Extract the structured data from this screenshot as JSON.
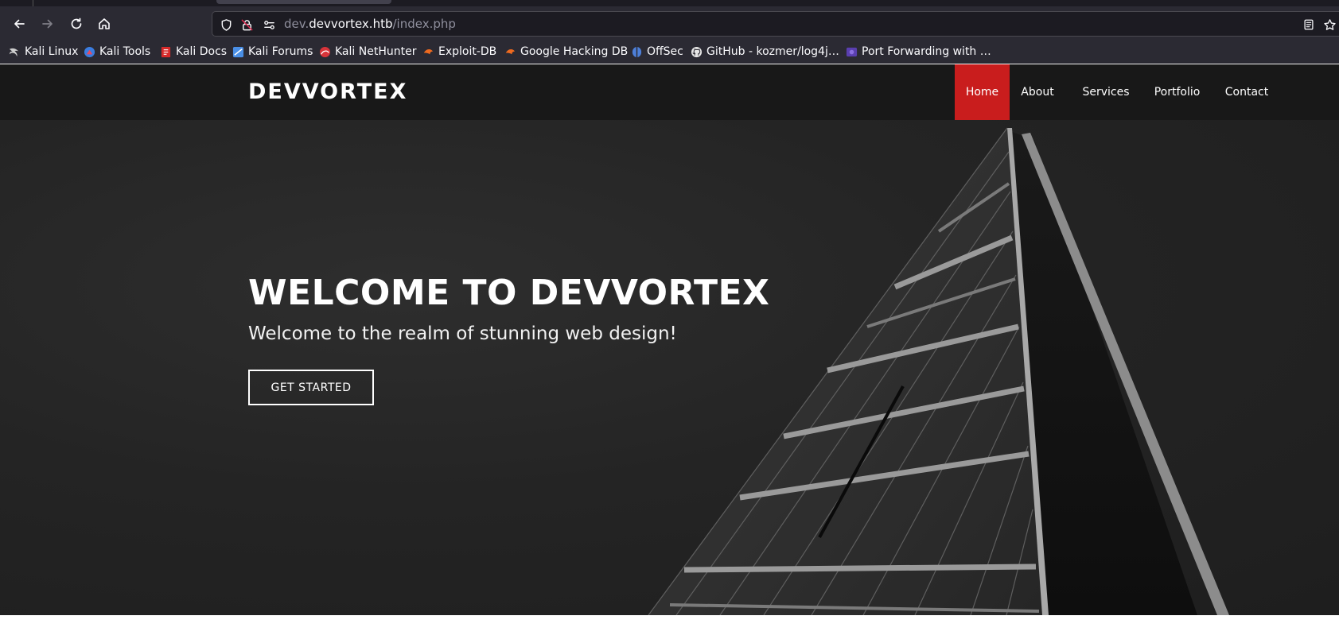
{
  "browser": {
    "url_prefix": "dev.",
    "url_host": "devvortex.htb",
    "url_path": "/index.php",
    "icons": {
      "back": "arrow-left-icon",
      "forward": "arrow-right-icon",
      "reload": "reload-icon",
      "home": "home-icon",
      "tracking": "shield-icon",
      "insecure": "lock-slash-icon",
      "permissions": "permissions-icon",
      "reader": "reader-view-icon",
      "bookmark": "star-icon"
    },
    "bookmarks": [
      {
        "label": "Kali Linux",
        "icon": "kali-dragon-icon",
        "color": "#cfcfcf"
      },
      {
        "label": "Kali Tools",
        "icon": "kali-tools-icon",
        "color": "#3b7de0"
      },
      {
        "label": "Kali Docs",
        "icon": "kali-docs-icon",
        "color": "#d82a2a"
      },
      {
        "label": "Kali Forums",
        "icon": "kali-forums-icon",
        "color": "#4a8fe6"
      },
      {
        "label": "Kali NetHunter",
        "icon": "nethunter-icon",
        "color": "#d8343a"
      },
      {
        "label": "Exploit-DB",
        "icon": "exploitdb-icon",
        "color": "#ef6a1f"
      },
      {
        "label": "Google Hacking DB",
        "icon": "ghdb-icon",
        "color": "#ef6a1f"
      },
      {
        "label": "OffSec",
        "icon": "offsec-icon",
        "color": "#4d7fd8"
      },
      {
        "label": "GitHub - kozmer/log4j…",
        "icon": "github-icon",
        "color": "#e6e6e6"
      },
      {
        "label": "Port Forwarding with …",
        "icon": "port-forwarding-icon",
        "color": "#5a3fb0"
      }
    ]
  },
  "site": {
    "brand": "DEVVORTEX",
    "nav": [
      {
        "label": "Home",
        "active": true
      },
      {
        "label": "About",
        "active": false
      },
      {
        "label": "Services",
        "active": false
      },
      {
        "label": "Portfolio",
        "active": false
      },
      {
        "label": "Contact",
        "active": false
      }
    ],
    "hero": {
      "title": "WELCOME TO DEVVORTEX",
      "subtitle": "Welcome to the realm of stunning web design!",
      "cta": "GET STARTED"
    },
    "accent_color": "#c91d1d"
  }
}
